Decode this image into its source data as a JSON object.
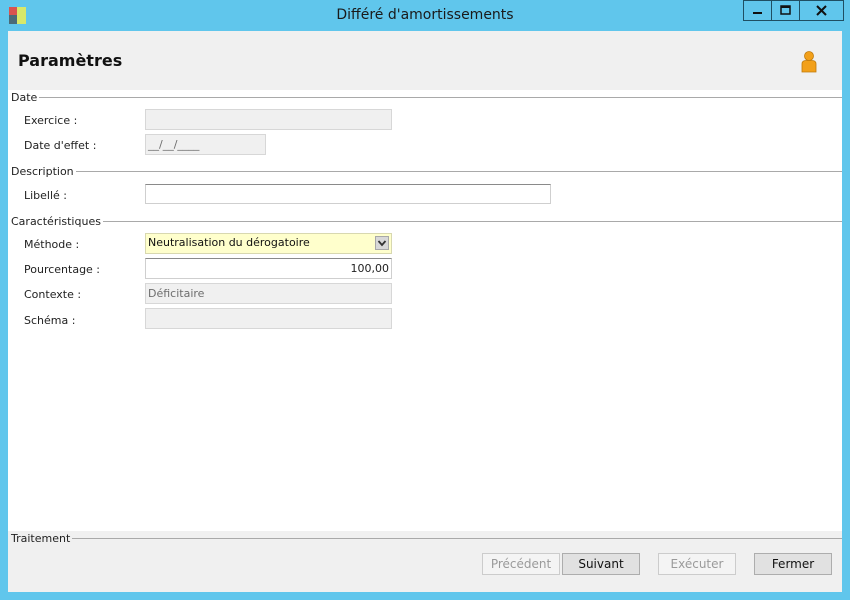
{
  "window": {
    "title": "Différé d'amortissements",
    "icon": "app-icon"
  },
  "header": {
    "title": "Paramètres",
    "user_icon": "user-icon"
  },
  "groups": {
    "date": "Date",
    "description": "Description",
    "caracteristiques": "Caractéristiques",
    "traitement": "Traitement"
  },
  "fields": {
    "exercice": {
      "label": "Exercice :",
      "value": ""
    },
    "date_effet": {
      "label": "Date d'effet :",
      "value": "__/__/____"
    },
    "libelle": {
      "label": "Libellé :",
      "value": ""
    },
    "methode": {
      "label": "Méthode :",
      "value": "Neutralisation du dérogatoire"
    },
    "pourcentage": {
      "label": "Pourcentage :",
      "value": "100,00"
    },
    "contexte": {
      "label": "Contexte :",
      "value": "Déficitaire"
    },
    "schema": {
      "label": "Schéma :",
      "value": ""
    }
  },
  "buttons": {
    "precedent": "Précédent",
    "suivant": "Suivant",
    "executer": "Exécuter",
    "fermer": "Fermer"
  },
  "colors": {
    "frame": "#60c6ec",
    "panel": "#f0f0f0",
    "highlight_field": "#ffffcc",
    "close_button": "#c7402f"
  }
}
